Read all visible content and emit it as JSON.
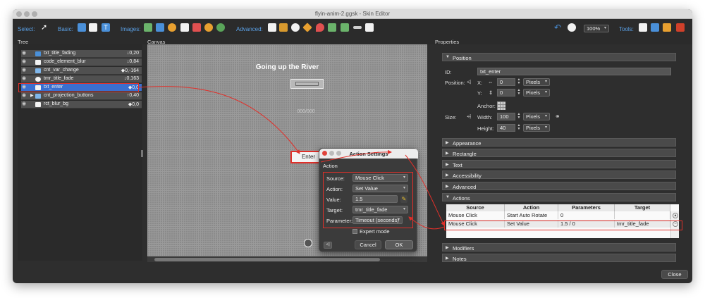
{
  "window": {
    "title": "flyin-anim-2.ggsk - Skin Editor"
  },
  "toolbar": {
    "select_label": "Select:",
    "basic_label": "Basic:",
    "images_label": "Images:",
    "advanced_label": "Advanced:",
    "tools_label": "Tools:",
    "zoom": "100%"
  },
  "panels": {
    "tree": "Tree",
    "canvas": "Canvas",
    "properties": "Properties"
  },
  "tree": {
    "items": [
      {
        "name": "txt_title_fading",
        "value": "↓0,20"
      },
      {
        "name": "code_element_blur",
        "value": "↓0,84"
      },
      {
        "name": "cnt_var_change",
        "value": "◆0,-164"
      },
      {
        "name": "tmr_title_fade",
        "value": "↓0,163"
      },
      {
        "name": "txt_enter",
        "value": "◆0,0"
      },
      {
        "name": "cnt_projection_buttons",
        "value": "↑0,40"
      },
      {
        "name": "rct_blur_bg",
        "value": "◆0,0"
      }
    ]
  },
  "canvas": {
    "heading": "Going up the River",
    "counter": "000/000",
    "enter_label": "Enter"
  },
  "dialog": {
    "title": "Action Settings",
    "section": "Action",
    "source_label": "Source:",
    "source_value": "Mouse Click",
    "action_label": "Action:",
    "action_value": "Set Value",
    "value_label": "Value:",
    "value_value": "1.5",
    "target_label": "Target:",
    "target_value": "tmr_title_fade",
    "parameter_label": "Parameter:",
    "parameter_value": "Timeout (seconds)",
    "expert_mode": "Expert mode",
    "cancel": "Cancel",
    "ok": "OK"
  },
  "properties": {
    "position_section": "Position",
    "id_label": "ID:",
    "id_value": "txt_enter",
    "position_label": "Position:",
    "x_label": "X:",
    "x_value": "0",
    "y_label": "Y:",
    "y_value": "0",
    "pixels": "Pixels",
    "anchor_label": "Anchor:",
    "size_label": "Size:",
    "width_label": "Width:",
    "width_value": "100",
    "height_label": "Height:",
    "height_value": "40",
    "sections": [
      "Appearance",
      "Rectangle",
      "Text",
      "Accessibility",
      "Advanced",
      "Actions",
      "Modifiers",
      "Notes"
    ],
    "actions_table": {
      "headers": [
        "Source",
        "Action",
        "Parameters",
        "Target"
      ],
      "rows": [
        [
          "Mouse Click",
          "Start Auto Rotate",
          "0",
          ""
        ],
        [
          "Mouse Click",
          "Set Value",
          "1.5 / 0",
          "tmr_title_fade"
        ]
      ]
    }
  },
  "close_label": "Close",
  "colors": {
    "accent_red": "#e0302a",
    "selection": "#3a6fcf",
    "toolbar_label": "#5aa0e6"
  }
}
